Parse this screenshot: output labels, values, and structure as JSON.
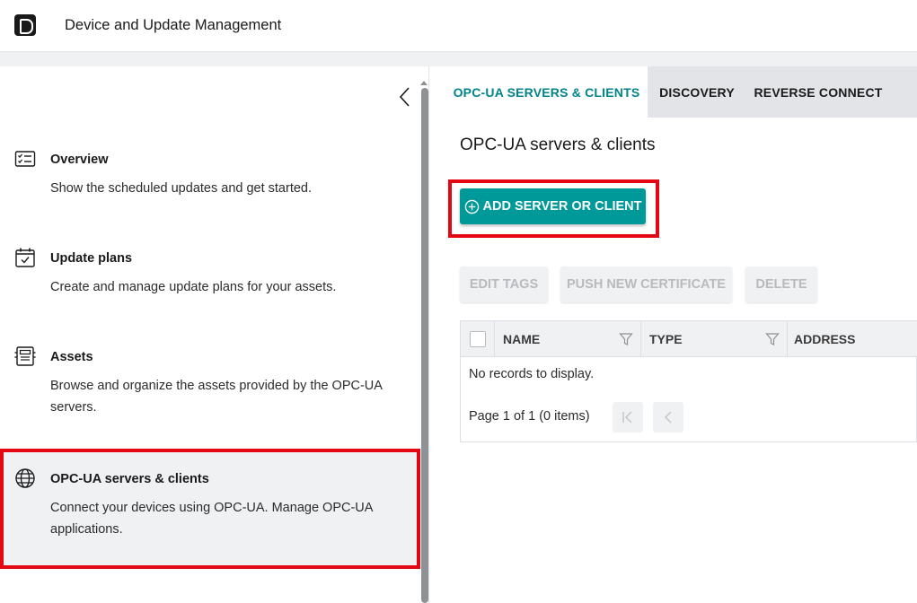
{
  "header": {
    "app_title": "Device and Update Management",
    "logo_icon": "app-logo-icon"
  },
  "sidebar": {
    "collapse_icon": "chevron-left-icon",
    "items": [
      {
        "icon": "checklist-icon",
        "title": "Overview",
        "description": "Show the scheduled updates and get started."
      },
      {
        "icon": "calendar-check-icon",
        "title": "Update plans",
        "description": "Create and manage update plans for your assets."
      },
      {
        "icon": "device-icon",
        "title": "Assets",
        "description": "Browse and organize the assets provided by the OPC-UA servers."
      },
      {
        "icon": "globe-icon",
        "title": "OPC-UA servers & clients",
        "description": "Connect your devices using OPC-UA. Manage OPC-UA applications.",
        "selected": true
      }
    ]
  },
  "main": {
    "tabs": [
      {
        "label": "OPC-UA SERVERS & CLIENTS",
        "active": true
      },
      {
        "label": "DISCOVERY",
        "active": false
      },
      {
        "label": "REVERSE CONNECT",
        "active": false
      }
    ],
    "page_title": "OPC-UA servers & clients",
    "add_button": "ADD SERVER OR CLIENT",
    "toolbar": {
      "edit_tags": "EDIT TAGS",
      "push_certificate": "PUSH NEW CERTIFICATE",
      "delete": "DELETE"
    },
    "grid": {
      "columns": [
        "NAME",
        "TYPE",
        "ADDRESS"
      ],
      "empty_message": "No records to display.",
      "pager_text": "Page 1 of 1 (0 items)"
    }
  },
  "colors": {
    "accent": "#009999",
    "tab_active": "#00848a",
    "highlight_frame": "#e30613",
    "tab_bar": "#e2e4e7",
    "disabled_button_bg": "#f0f1f3",
    "disabled_button_text": "#b8babd"
  }
}
